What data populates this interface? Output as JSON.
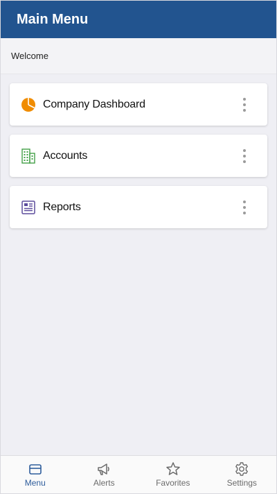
{
  "header": {
    "title": "Main Menu",
    "color": "#22548f"
  },
  "welcome": {
    "text": "Welcome"
  },
  "menu": {
    "items": [
      {
        "label": "Company Dashboard",
        "icon": "pie-chart-icon",
        "icon_color": "#f08c00"
      },
      {
        "label": "Accounts",
        "icon": "building-icon",
        "icon_color": "#43a047"
      },
      {
        "label": "Reports",
        "icon": "newspaper-icon",
        "icon_color": "#5c4b9c"
      }
    ]
  },
  "tabbar": {
    "active": "menu",
    "tabs": [
      {
        "label": "Menu",
        "icon": "menu-box-icon"
      },
      {
        "label": "Alerts",
        "icon": "megaphone-icon"
      },
      {
        "label": "Favorites",
        "icon": "star-icon"
      },
      {
        "label": "Settings",
        "icon": "gear-icon"
      }
    ]
  }
}
